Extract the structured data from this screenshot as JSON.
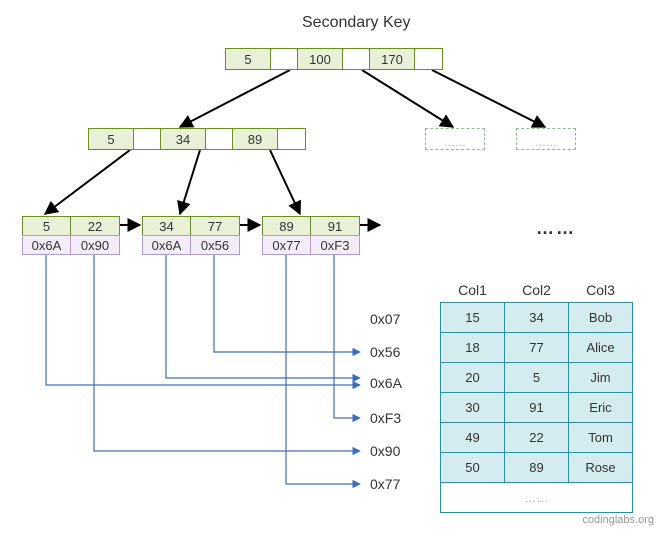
{
  "title": "Secondary Key",
  "root": {
    "keys": [
      "5",
      "100",
      "170"
    ]
  },
  "mid": {
    "keys": [
      "5",
      "34",
      "89"
    ]
  },
  "leaves": [
    {
      "keys": [
        "5",
        "22"
      ],
      "ptrs": [
        "0x6A",
        "0x90"
      ]
    },
    {
      "keys": [
        "34",
        "77"
      ],
      "ptrs": [
        "0x6A",
        "0x56"
      ]
    },
    {
      "keys": [
        "89",
        "91"
      ],
      "ptrs": [
        "0x77",
        "0xF3"
      ]
    }
  ],
  "ghost_text": "……",
  "leaf_continuation": "……",
  "addresses": [
    "0x07",
    "0x56",
    "0x6A",
    "0xF3",
    "0x90",
    "0x77"
  ],
  "table": {
    "headers": [
      "Col1",
      "Col2",
      "Col3"
    ],
    "rows": [
      [
        "15",
        "34",
        "Bob"
      ],
      [
        "18",
        "77",
        "Alice"
      ],
      [
        "20",
        "5",
        "Jim"
      ],
      [
        "30",
        "91",
        "Eric"
      ],
      [
        "49",
        "22",
        "Tom"
      ],
      [
        "50",
        "89",
        "Rose"
      ]
    ],
    "footer": "……"
  },
  "watermark": "codinglabs.org"
}
